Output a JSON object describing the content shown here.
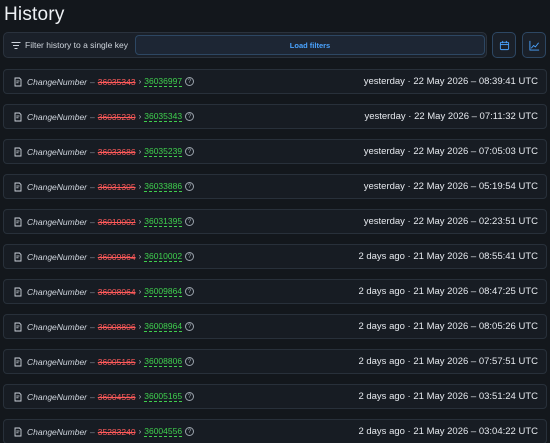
{
  "page": {
    "title": "History"
  },
  "filters": {
    "label": "Filter history to a single key",
    "load_button": "Load filters"
  },
  "toolbar": {
    "icons": [
      "calendar-icon",
      "chart-icon"
    ]
  },
  "colors": {
    "old_value": "#ff5a5a",
    "new_value": "#3fd04e",
    "accent": "#4aa3ff"
  },
  "history": [
    {
      "key": "ChangeNumber",
      "old": "36035343",
      "new": "36036997",
      "time": "yesterday · 22 May 2026 – 08:39:41 UTC"
    },
    {
      "key": "ChangeNumber",
      "old": "36035230",
      "new": "36035343",
      "time": "yesterday · 22 May 2026 – 07:11:32 UTC"
    },
    {
      "key": "ChangeNumber",
      "old": "36033686",
      "new": "36035239",
      "time": "yesterday · 22 May 2026 – 07:05:03 UTC"
    },
    {
      "key": "ChangeNumber",
      "old": "36031305",
      "new": "36033886",
      "time": "yesterday · 22 May 2026 – 05:19:54 UTC"
    },
    {
      "key": "ChangeNumber",
      "old": "36010002",
      "new": "36031395",
      "time": "yesterday · 22 May 2026 – 02:23:51 UTC"
    },
    {
      "key": "ChangeNumber",
      "old": "36009864",
      "new": "36010002",
      "time": "2 days ago · 21 May 2026 – 08:55:41 UTC"
    },
    {
      "key": "ChangeNumber",
      "old": "36008064",
      "new": "36009864",
      "time": "2 days ago · 21 May 2026 – 08:47:25 UTC"
    },
    {
      "key": "ChangeNumber",
      "old": "36008806",
      "new": "36008964",
      "time": "2 days ago · 21 May 2026 – 08:05:26 UTC"
    },
    {
      "key": "ChangeNumber",
      "old": "36005165",
      "new": "36008806",
      "time": "2 days ago · 21 May 2026 – 07:57:51 UTC"
    },
    {
      "key": "ChangeNumber",
      "old": "36004556",
      "new": "36005165",
      "time": "2 days ago · 21 May 2026 – 03:51:24 UTC"
    },
    {
      "key": "ChangeNumber",
      "old": "35283240",
      "new": "36004556",
      "time": "2 days ago · 21 May 2026 – 03:04:22 UTC"
    }
  ]
}
